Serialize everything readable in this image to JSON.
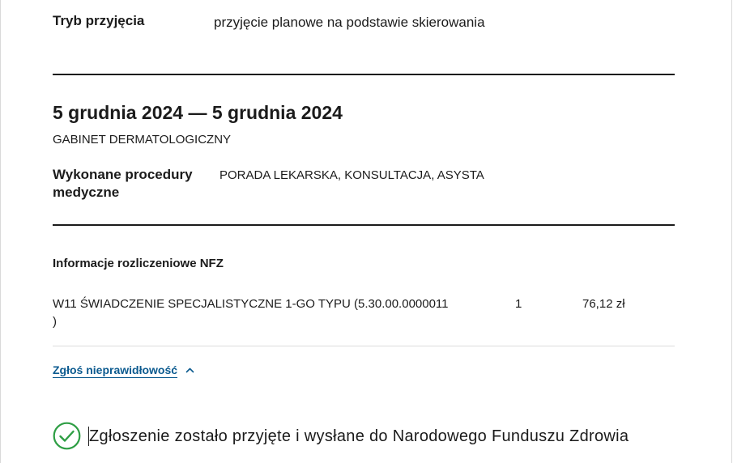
{
  "admission": {
    "label": "Tryb przyjęcia",
    "value": "przyjęcie planowe na podstawie skierowania"
  },
  "visit": {
    "date_range": "5 grudnia 2024 — 5 grudnia 2024",
    "unit": "GABINET DERMATOLOGICZNY",
    "procedures_label_line1": "Wykonane procedury",
    "procedures_label_line2": "medyczne",
    "procedures_value": "PORADA LEKARSKA, KONSULTACJA, ASYSTA"
  },
  "settlement": {
    "title": "Informacje rozliczeniowe NFZ",
    "rows": [
      {
        "description_line1": "W11 ŚWIADCZENIE SPECJALISTYCZNE 1-GO TYPU (5.30.00.0000011",
        "description_line2": ")",
        "quantity": "1",
        "amount": "76,12 zł"
      }
    ]
  },
  "report": {
    "link_label": "Zgłoś nieprawidłowość",
    "toggle_icon": "chevron-up-icon"
  },
  "confirmation": {
    "icon": "check-circle-icon",
    "message": "Zgłoszenie zostało przyjęte i wysłane do Narodowego Funduszu Zdrowia"
  },
  "colors": {
    "link": "#0b5a8f",
    "success": "#2e9e44",
    "text": "#1b1b1b"
  }
}
